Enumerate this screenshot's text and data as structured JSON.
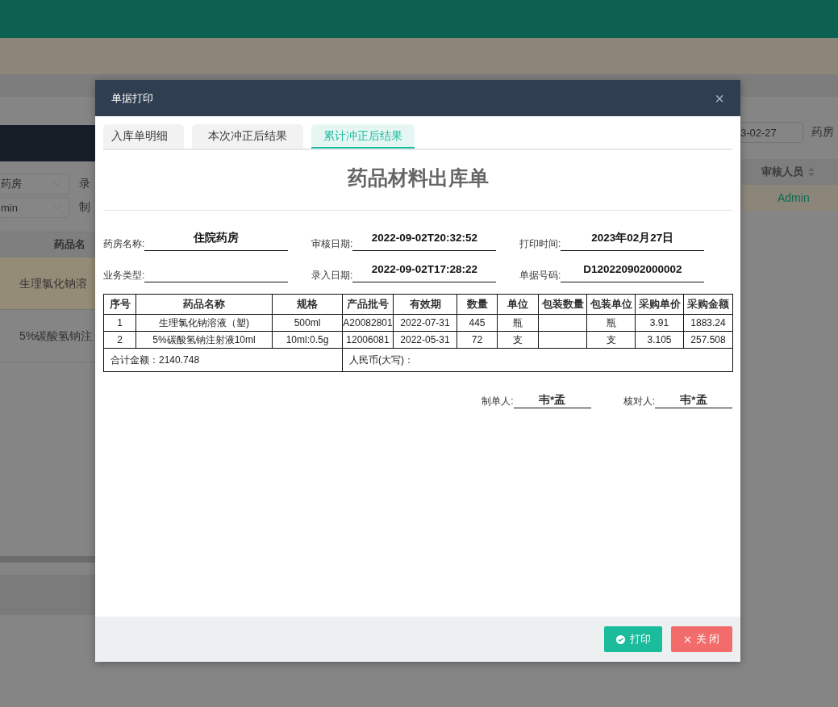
{
  "background": {
    "filters": [
      {
        "value": "药房",
        "label": "录"
      },
      {
        "value": "min",
        "label": "制"
      }
    ],
    "table_header": "药品名",
    "rows": [
      {
        "text": "生理氯化钠溶",
        "selected": true
      },
      {
        "text": "5%碳酸氢钠注",
        "selected": false
      }
    ],
    "date_value": "3-02-27",
    "date_label": "药房",
    "right_header": "审核人员",
    "right_cell": "Admin"
  },
  "dialog": {
    "title": "单据打印",
    "close": "×",
    "tabs": [
      {
        "label": "入库单明细",
        "selected": false
      },
      {
        "label": "本次冲正后结果",
        "selected": false
      },
      {
        "label": "累计冲正后结果",
        "selected": true
      }
    ],
    "heading": "药品材料出库单",
    "fields": [
      {
        "label": "药房名称:",
        "value": "住院药房"
      },
      {
        "label": "审核日期:",
        "value": "2022-09-02T20:32:52"
      },
      {
        "label": "打印时间:",
        "value": "2023年02月27日"
      },
      {
        "label": "业务类型:"
      },
      {
        "label": "录入日期:",
        "value": "2022-09-02T17:28:22"
      },
      {
        "label": "单据号码:",
        "value": "D120220902000002"
      }
    ],
    "table": {
      "columns": [
        "序号",
        "药品名称",
        "规格",
        "产品批号",
        "有效期",
        "数量",
        "单位",
        "包装数量",
        "包装单位",
        "采购单价",
        "采购金额"
      ],
      "rows": [
        [
          "1",
          "生理氯化钠溶液（塑)",
          "500ml",
          "A20082801",
          "2022-07-31",
          "445",
          "瓶",
          "",
          "瓶",
          "3.91",
          "1883.24"
        ],
        [
          "2",
          "5%碳酸氢钠注射液10ml",
          "10ml:0.5g",
          "12006081",
          "2022-05-31",
          "72",
          "支",
          "",
          "支",
          "3.105",
          "257.508"
        ]
      ],
      "total": "合计金额：2140.748",
      "rmb": "人民币(大写)："
    },
    "signatures": [
      {
        "label": "制单人:",
        "value": "韦*孟"
      },
      {
        "label": "核对人:",
        "value": "韦*孟"
      }
    ],
    "buttons": [
      {
        "label": "打印",
        "kind": "primary"
      },
      {
        "label": "关 闭",
        "kind": "danger"
      }
    ]
  }
}
